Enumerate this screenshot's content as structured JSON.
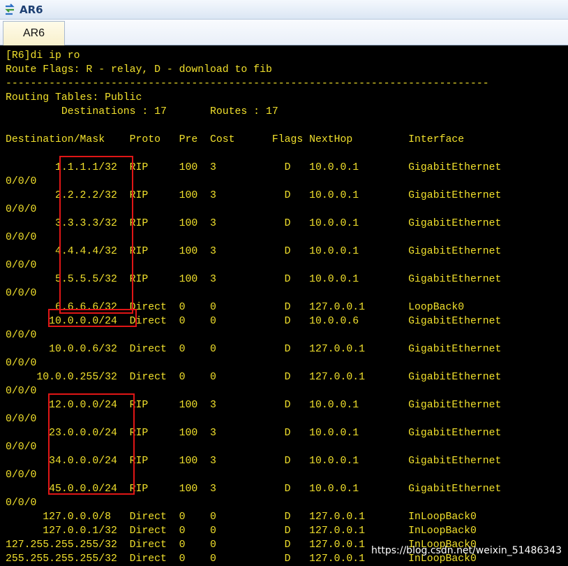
{
  "window": {
    "title": "AR6",
    "tab": "AR6"
  },
  "terminal": {
    "lines": [
      "[R6]di ip ro",
      "Route Flags: R - relay, D - download to fib",
      "------------------------------------------------------------------------------",
      "Routing Tables: Public",
      "         Destinations : 17       Routes : 17",
      "",
      "Destination/Mask    Proto   Pre  Cost      Flags NextHop         Interface",
      "",
      "        1.1.1.1/32  RIP     100  3           D   10.0.0.1        GigabitEthernet",
      "0/0/0",
      "        2.2.2.2/32  RIP     100  3           D   10.0.0.1        GigabitEthernet",
      "0/0/0",
      "        3.3.3.3/32  RIP     100  3           D   10.0.0.1        GigabitEthernet",
      "0/0/0",
      "        4.4.4.4/32  RIP     100  3           D   10.0.0.1        GigabitEthernet",
      "0/0/0",
      "        5.5.5.5/32  RIP     100  3           D   10.0.0.1        GigabitEthernet",
      "0/0/0",
      "        6.6.6.6/32  Direct  0    0           D   127.0.0.1       LoopBack0",
      "       10.0.0.0/24  Direct  0    0           D   10.0.0.6        GigabitEthernet",
      "0/0/0",
      "       10.0.0.6/32  Direct  0    0           D   127.0.0.1       GigabitEthernet",
      "0/0/0",
      "     10.0.0.255/32  Direct  0    0           D   127.0.0.1       GigabitEthernet",
      "0/0/0",
      "       12.0.0.0/24  RIP     100  3           D   10.0.0.1        GigabitEthernet",
      "0/0/0",
      "       23.0.0.0/24  RIP     100  3           D   10.0.0.1        GigabitEthernet",
      "0/0/0",
      "       34.0.0.0/24  RIP     100  3           D   10.0.0.1        GigabitEthernet",
      "0/0/0",
      "       45.0.0.0/24  RIP     100  3           D   10.0.0.1        GigabitEthernet",
      "0/0/0",
      "      127.0.0.0/8   Direct  0    0           D   127.0.0.1       InLoopBack0",
      "      127.0.0.1/32  Direct  0    0           D   127.0.0.1       InLoopBack0",
      "127.255.255.255/32  Direct  0    0           D   127.0.0.1       InLoopBack0",
      "255.255.255.255/32  Direct  0    0           D   127.0.0.1       InLoopBack0"
    ]
  },
  "watermark": "https://blog.csdn.net/weixin_51486343"
}
